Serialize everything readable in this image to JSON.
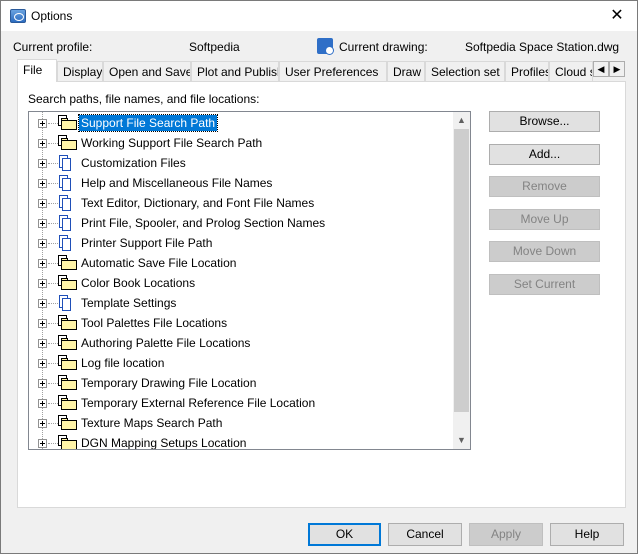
{
  "window": {
    "title": "Options"
  },
  "profile": {
    "label": "Current profile:",
    "value": "Softpedia",
    "drawing_label": "Current drawing:",
    "drawing_value": "Softpedia Space Station.dwg"
  },
  "tabs": [
    {
      "label": "File",
      "active": true
    },
    {
      "label": "Display"
    },
    {
      "label": "Open and Save"
    },
    {
      "label": "Plot and Publish"
    },
    {
      "label": "User Preferences"
    },
    {
      "label": "Draw"
    },
    {
      "label": "Selection set"
    },
    {
      "label": "Profiles"
    },
    {
      "label": "Cloud stora"
    }
  ],
  "panel": {
    "label": "Search paths, file names, and file locations:"
  },
  "tree": [
    {
      "label": "Support File Search Path",
      "icon": "folder-icon",
      "selected": true
    },
    {
      "label": "Working Support File Search Path",
      "icon": "folder-icon"
    },
    {
      "label": "Customization Files",
      "icon": "file-icon"
    },
    {
      "label": "Help and Miscellaneous File Names",
      "icon": "file-icon"
    },
    {
      "label": "Text Editor, Dictionary, and Font File Names",
      "icon": "file-icon"
    },
    {
      "label": "Print File, Spooler, and Prolog Section Names",
      "icon": "file-icon"
    },
    {
      "label": "Printer Support File Path",
      "icon": "file-icon"
    },
    {
      "label": "Automatic Save File Location",
      "icon": "folder-icon"
    },
    {
      "label": "Color Book Locations",
      "icon": "folder-icon"
    },
    {
      "label": "Template Settings",
      "icon": "file-icon"
    },
    {
      "label": "Tool Palettes File Locations",
      "icon": "folder-icon"
    },
    {
      "label": "Authoring Palette File Locations",
      "icon": "folder-icon"
    },
    {
      "label": "Log file location",
      "icon": "folder-icon"
    },
    {
      "label": "Temporary Drawing File Location",
      "icon": "folder-icon"
    },
    {
      "label": "Temporary External Reference File Location",
      "icon": "folder-icon"
    },
    {
      "label": "Texture Maps Search Path",
      "icon": "folder-icon"
    },
    {
      "label": "DGN Mapping Setups Location",
      "icon": "folder-icon"
    }
  ],
  "side_buttons": [
    {
      "label": "Browse...",
      "enabled": true
    },
    {
      "label": "Add...",
      "enabled": true
    },
    {
      "label": "Remove",
      "enabled": false
    },
    {
      "label": "Move Up",
      "enabled": false
    },
    {
      "label": "Move Down",
      "enabled": false
    },
    {
      "label": "Set Current",
      "enabled": false
    }
  ],
  "bottom_buttons": [
    {
      "label": "OK",
      "enabled": true,
      "default": true
    },
    {
      "label": "Cancel",
      "enabled": true
    },
    {
      "label": "Apply",
      "enabled": false
    },
    {
      "label": "Help",
      "enabled": true
    }
  ]
}
